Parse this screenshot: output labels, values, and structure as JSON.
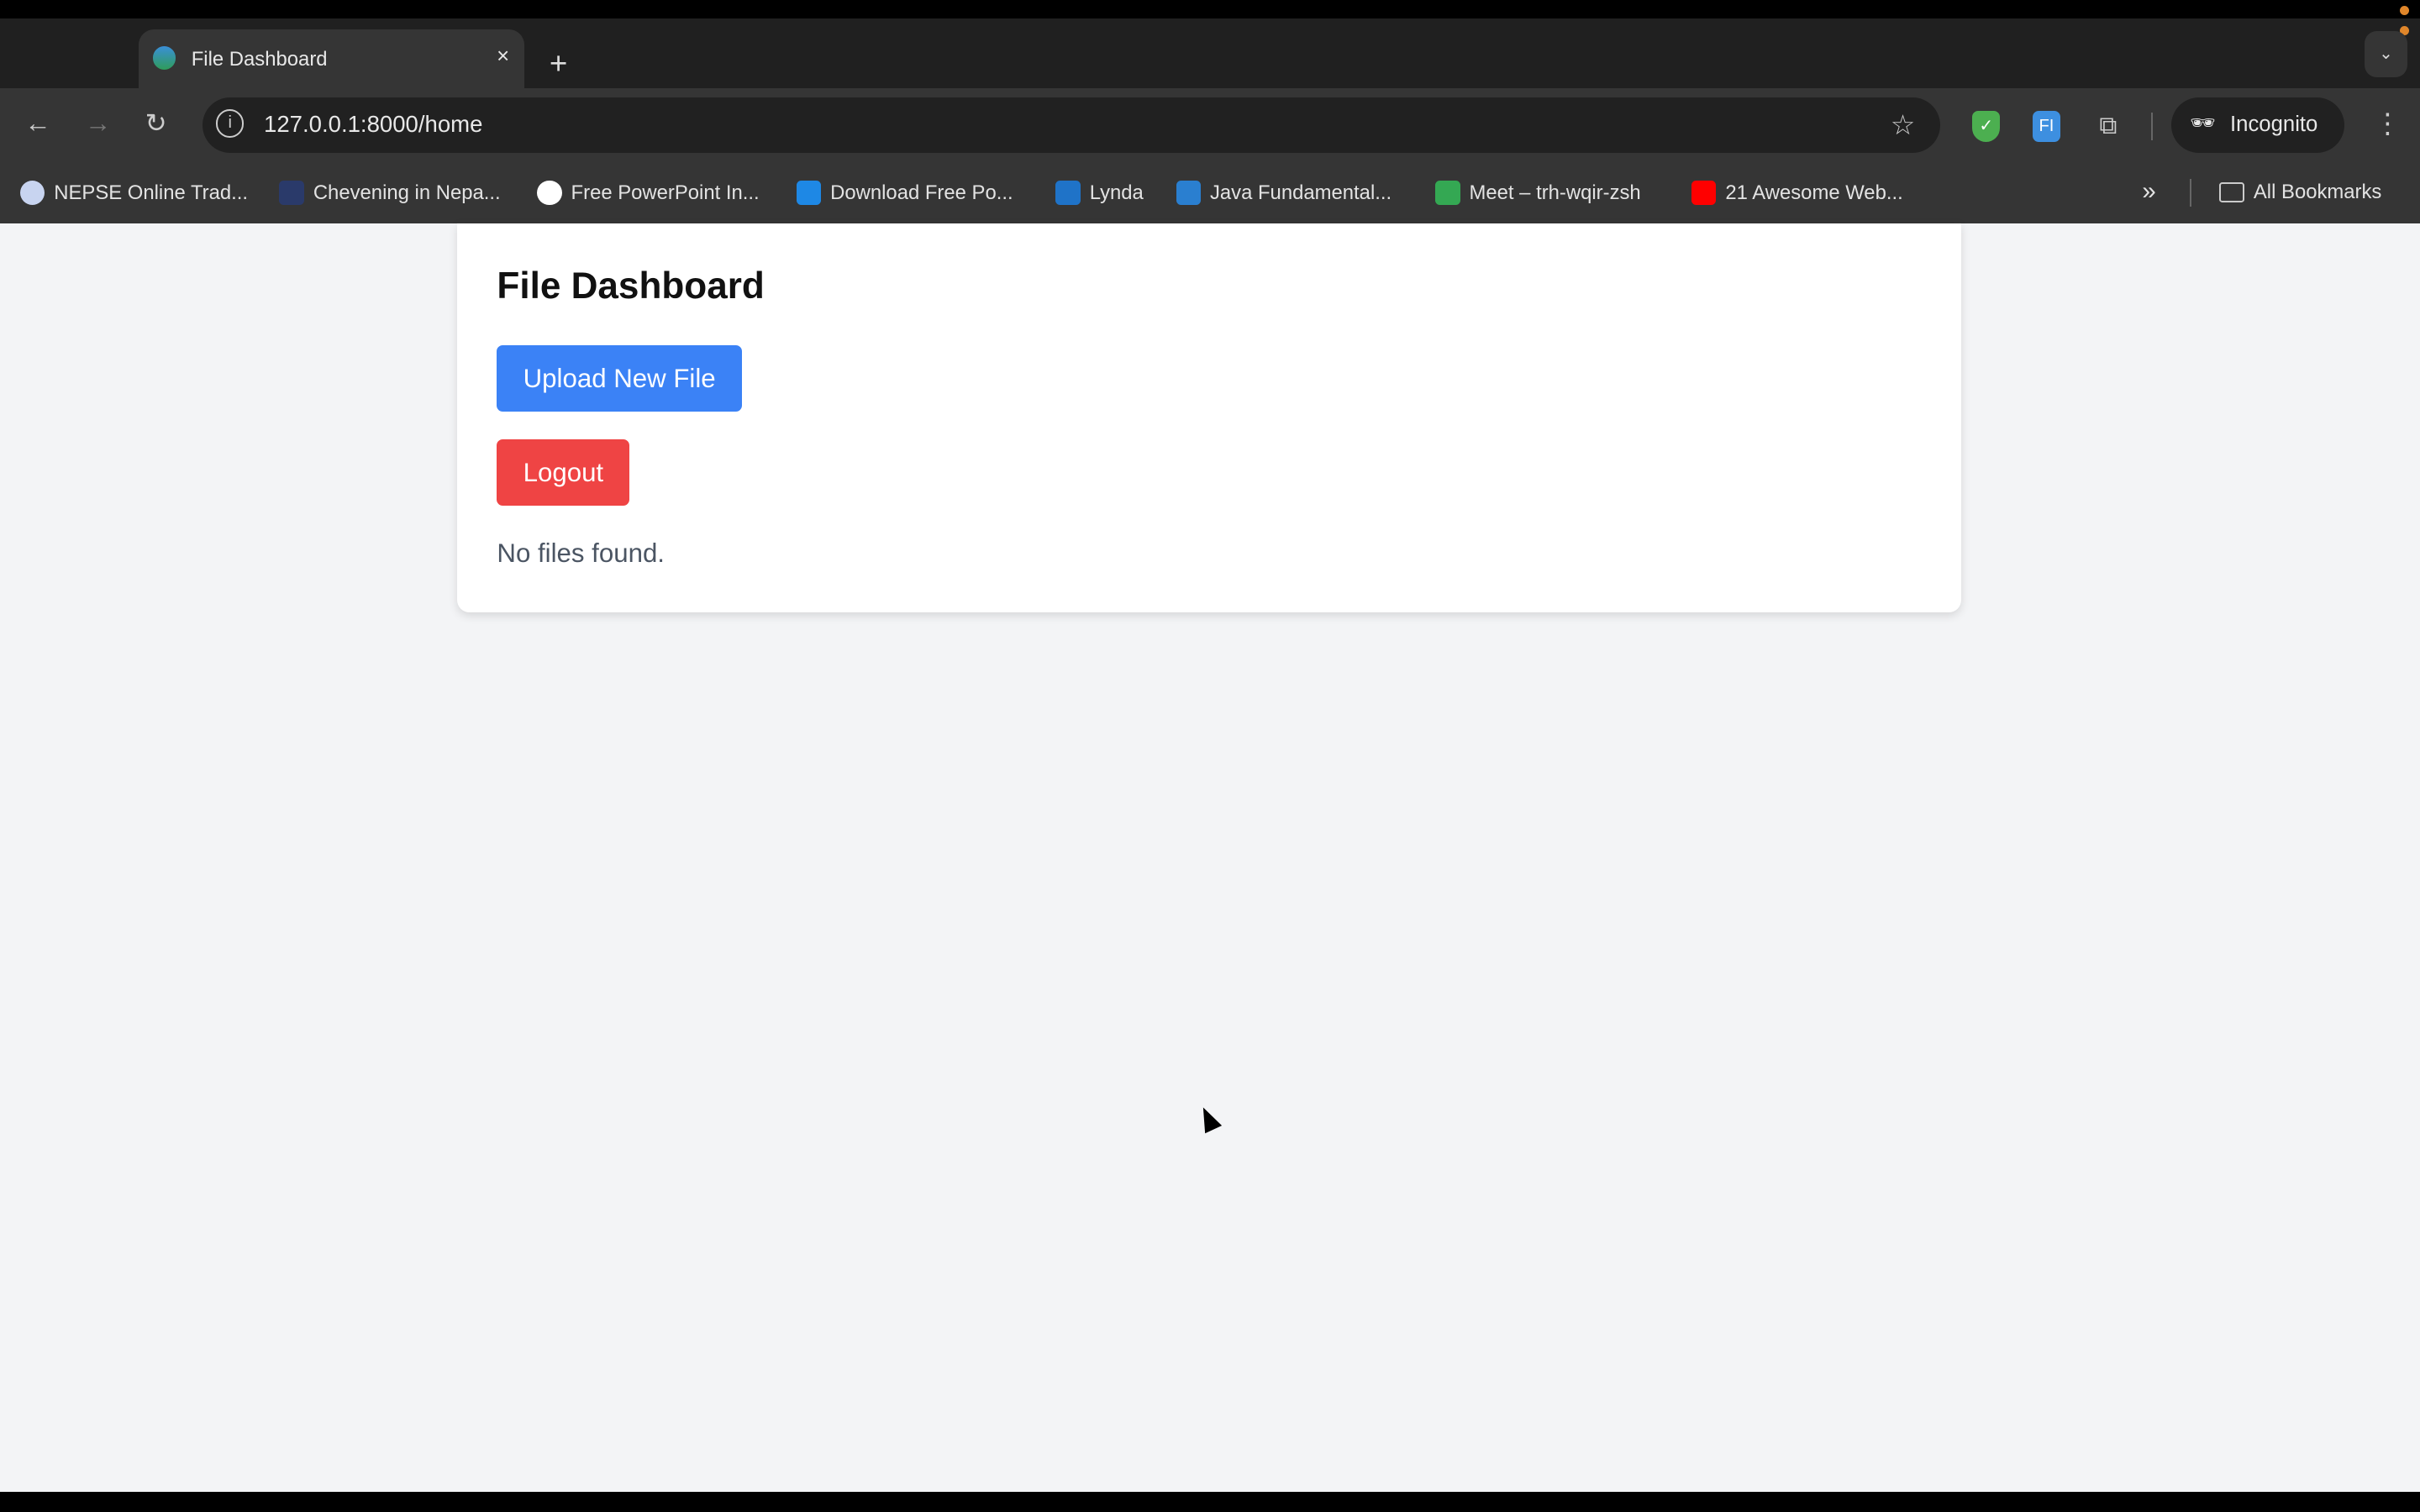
{
  "browser": {
    "tab": {
      "title": "File Dashboard",
      "close": "×"
    },
    "new_tab": "+",
    "tab_menu": "⌄",
    "nav": {
      "back": "←",
      "forward": "→",
      "reload": "↻"
    },
    "url": "127.0.0.1:8000/home",
    "star": "☆",
    "incognito_label": "Incognito",
    "menu": "⋮",
    "extensions": [
      {
        "name": "adguard",
        "color": "#4caf50",
        "glyph": "✓"
      },
      {
        "name": "fi",
        "color": "#3d8fe0",
        "glyph": "FI"
      },
      {
        "name": "puzzle",
        "color": "transparent",
        "glyph": "⧉"
      }
    ],
    "bookmarks": [
      {
        "label": "NEPSE Online Trad...",
        "color": "#c8d4f0"
      },
      {
        "label": "Chevening in Nepa...",
        "color": "#2a3a6a"
      },
      {
        "label": "Free PowerPoint In...",
        "color": "#ffffff"
      },
      {
        "label": "Download Free Po...",
        "color": "#1e88e5"
      },
      {
        "label": "Lynda",
        "color": "#1f73c8"
      },
      {
        "label": "Java Fundamental...",
        "color": "#2a7fd0"
      },
      {
        "label": "Meet – trh-wqir-zsh",
        "color": "#34a853"
      },
      {
        "label": "21 Awesome Web...",
        "color": "#ff0000"
      }
    ],
    "overflow": "»",
    "all_bookmarks": "All Bookmarks"
  },
  "page": {
    "title": "File Dashboard",
    "upload_button": "Upload New File",
    "logout_button": "Logout",
    "empty_message": "No files found."
  },
  "colors": {
    "primary": "#3b82f6",
    "danger": "#ef4444",
    "background": "#f3f4f6"
  }
}
